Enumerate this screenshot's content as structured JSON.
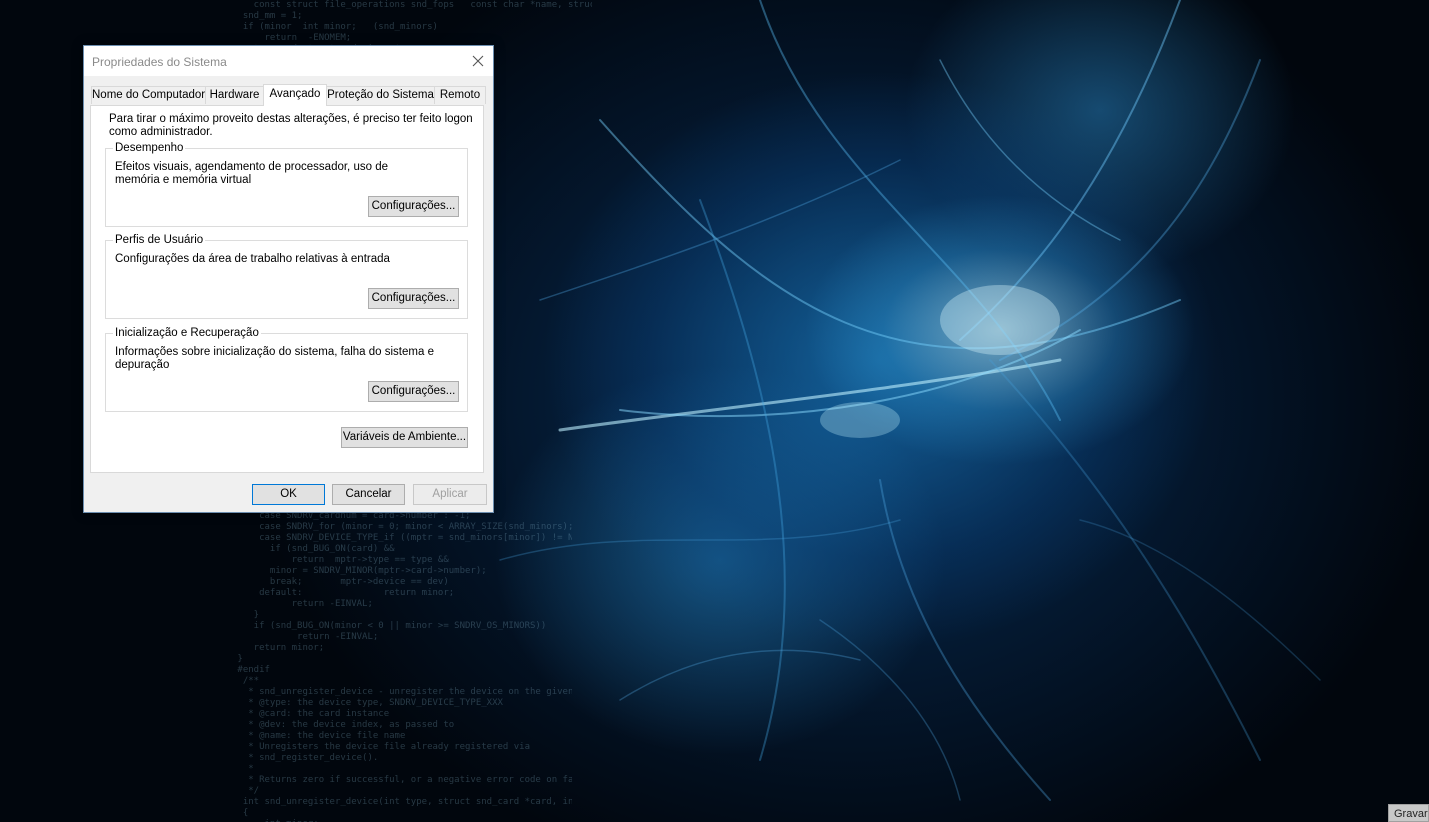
{
  "dialog": {
    "title": "Propriedades do Sistema",
    "tabs": [
      {
        "label": "Nome do Computador",
        "active": false
      },
      {
        "label": "Hardware",
        "active": false
      },
      {
        "label": "Avançado",
        "active": true
      },
      {
        "label": "Proteção do Sistema",
        "active": false
      },
      {
        "label": "Remoto",
        "active": false
      }
    ],
    "intro_text": "Para tirar o máximo proveito destas alterações, é preciso ter feito logon como administrador.",
    "groups": [
      {
        "title": "Desempenho",
        "description": "Efeitos visuais, agendamento de processador, uso de memória e memória virtual",
        "button_label": "Configurações..."
      },
      {
        "title": "Perfis de Usuário",
        "description": "Configurações da área de trabalho relativas à entrada",
        "button_label": "Configurações..."
      },
      {
        "title": "Inicialização e Recuperação",
        "description": "Informações sobre inicialização do sistema, falha do sistema e depuração",
        "button_label": "Configurações..."
      }
    ],
    "env_button_label": "Variáveis de Ambiente...",
    "ok_label": "OK",
    "cancel_label": "Cancelar",
    "apply_label": "Aplicar",
    "apply_enabled": false
  },
  "desktop": {
    "corner_widget_label": "Gravar"
  },
  "colors": {
    "accent": "#0078d7",
    "dialog_bg": "#f0f0f0",
    "wallpaper_glow": "#3fb3ee"
  },
  "icons": [
    "close-icon"
  ]
}
